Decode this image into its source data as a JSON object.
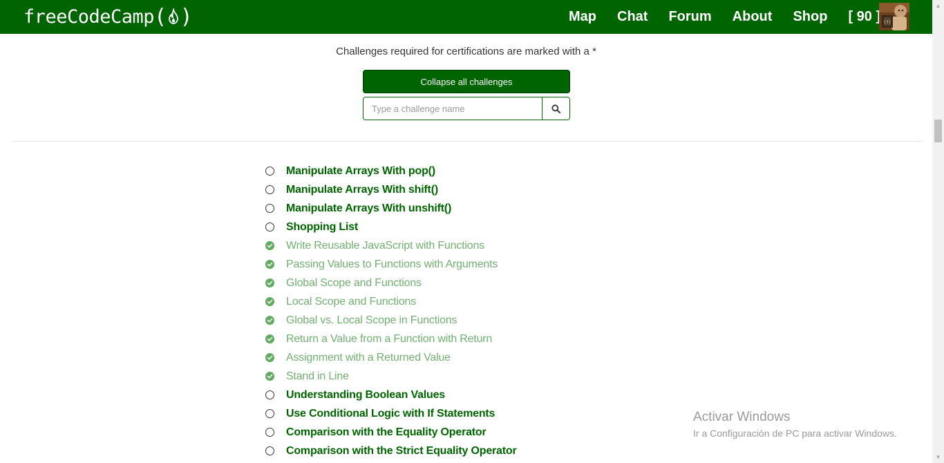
{
  "navbar": {
    "logo_text": "freeCodeCamp",
    "logo_icon": "flame-icon",
    "links": [
      "Map",
      "Chat",
      "Forum",
      "About",
      "Shop",
      "[ 90 ]"
    ],
    "bg_color": "#006400"
  },
  "header": {
    "cert_note": "Challenges required for certifications are marked with a *",
    "collapse_label": "Collapse all challenges",
    "search_placeholder": "Type a challenge name",
    "search_icon": "search-icon"
  },
  "challenges": [
    {
      "title": "Manipulate Arrays With pop()",
      "completed": false
    },
    {
      "title": "Manipulate Arrays With shift()",
      "completed": false
    },
    {
      "title": "Manipulate Arrays With unshift()",
      "completed": false
    },
    {
      "title": "Shopping List",
      "completed": false
    },
    {
      "title": "Write Reusable JavaScript with Functions",
      "completed": true
    },
    {
      "title": "Passing Values to Functions with Arguments",
      "completed": true
    },
    {
      "title": "Global Scope and Functions",
      "completed": true
    },
    {
      "title": "Local Scope and Functions",
      "completed": true
    },
    {
      "title": "Global vs. Local Scope in Functions",
      "completed": true
    },
    {
      "title": "Return a Value from a Function with Return",
      "completed": true
    },
    {
      "title": "Assignment with a Returned Value",
      "completed": true
    },
    {
      "title": "Stand in Line",
      "completed": true
    },
    {
      "title": "Understanding Boolean Values",
      "completed": false
    },
    {
      "title": "Use Conditional Logic with If Statements",
      "completed": false
    },
    {
      "title": "Comparison with the Equality Operator",
      "completed": false
    },
    {
      "title": "Comparison with the Strict Equality Operator",
      "completed": false
    }
  ],
  "watermark": {
    "title": "Activar Windows",
    "subtitle": "Ir a Configuración de PC para activar Windows."
  }
}
